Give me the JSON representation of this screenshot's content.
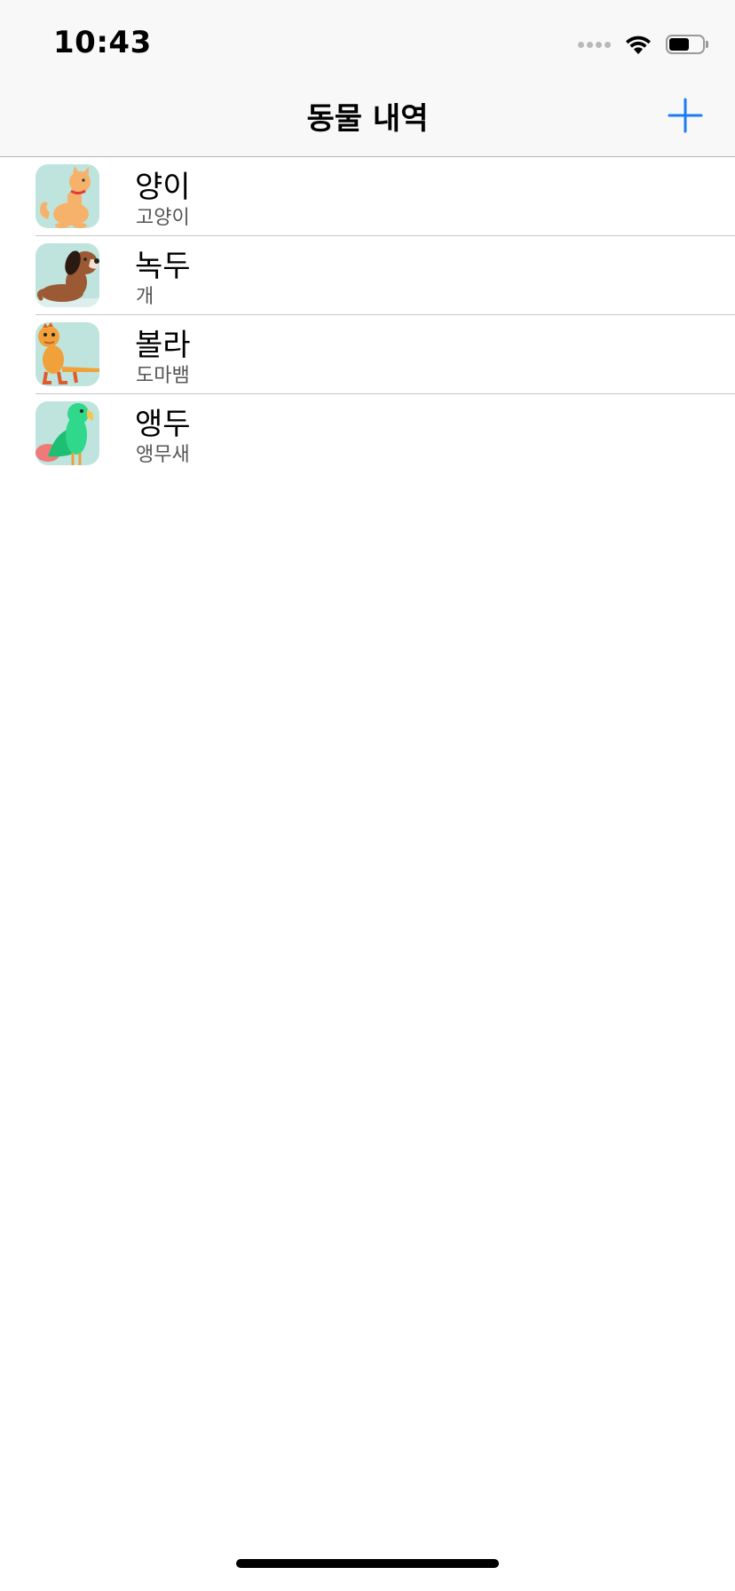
{
  "status_bar": {
    "time": "10:43",
    "signal_icon": "cellular-signal-icon",
    "wifi_icon": "wifi-icon",
    "battery_icon": "battery-icon",
    "battery_level": 0.6
  },
  "nav": {
    "title": "동물 내역",
    "add_icon": "plus-icon"
  },
  "animals": [
    {
      "name": "양이",
      "species": "고양이",
      "icon": "cat-icon"
    },
    {
      "name": "녹두",
      "species": "개",
      "icon": "dog-icon"
    },
    {
      "name": "볼라",
      "species": "도마뱀",
      "icon": "lizard-icon"
    },
    {
      "name": "앵두",
      "species": "앵무새",
      "icon": "parrot-icon"
    }
  ],
  "colors": {
    "accent": "#1a7cf5",
    "thumb_bg": "#bfe4de",
    "nav_bg": "#f8f8f8"
  }
}
